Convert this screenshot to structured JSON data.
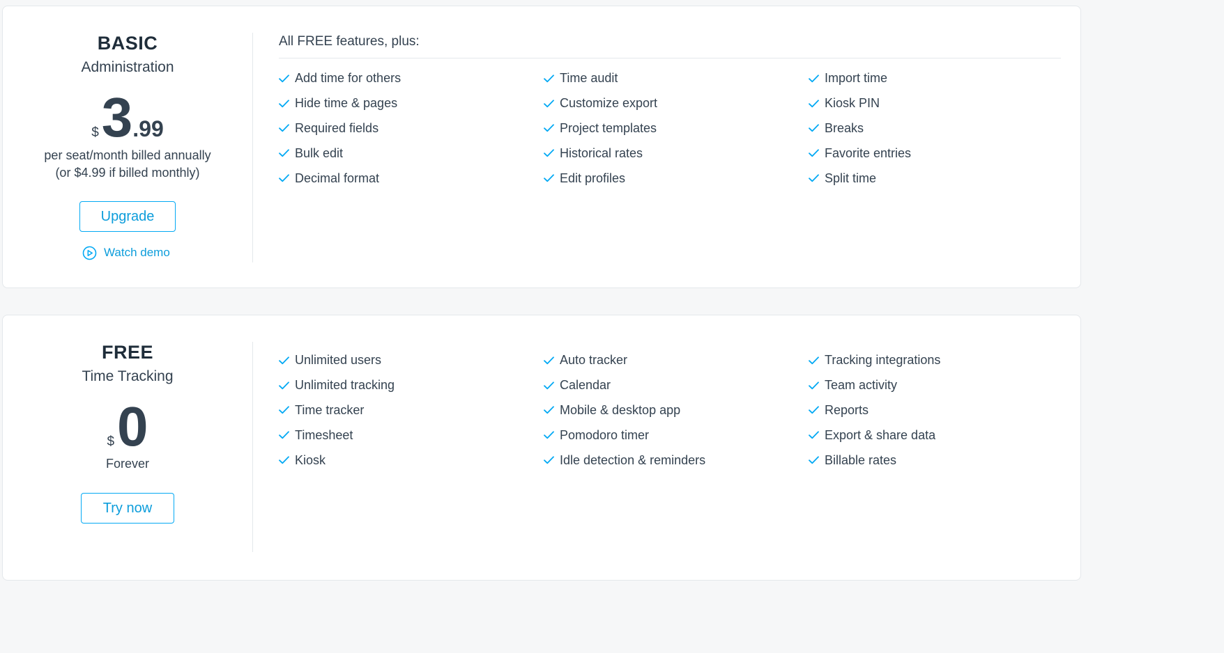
{
  "accent_color": "#03a9f4",
  "basic": {
    "name": "BASIC",
    "subtitle": "Administration",
    "price": {
      "currency": "$",
      "integer": "3",
      "decimal": ".99"
    },
    "note_line1": "per seat/month billed annually",
    "note_line2": "(or $4.99 if billed monthly)",
    "cta_label": "Upgrade",
    "demo_label": "Watch demo",
    "demo_icon": "play-circle-icon",
    "features_heading": "All FREE features, plus:",
    "features": [
      "Add time for others",
      "Time audit",
      "Import time",
      "Hide time & pages",
      "Customize export",
      "Kiosk PIN",
      "Required fields",
      "Project templates",
      "Breaks",
      "Bulk edit",
      "Historical rates",
      "Favorite entries",
      "Decimal format",
      "Edit profiles",
      "Split time"
    ]
  },
  "free": {
    "name": "FREE",
    "subtitle": "Time Tracking",
    "price": {
      "currency": "$",
      "integer": "0"
    },
    "note": "Forever",
    "cta_label": "Try now",
    "features": [
      "Unlimited users",
      "Auto tracker",
      "Tracking integrations",
      "Unlimited tracking",
      "Calendar",
      "Team activity",
      "Time tracker",
      "Mobile & desktop app",
      "Reports",
      "Timesheet",
      "Pomodoro timer",
      "Export & share data",
      "Kiosk",
      "Idle detection & reminders",
      "Billable rates"
    ]
  }
}
